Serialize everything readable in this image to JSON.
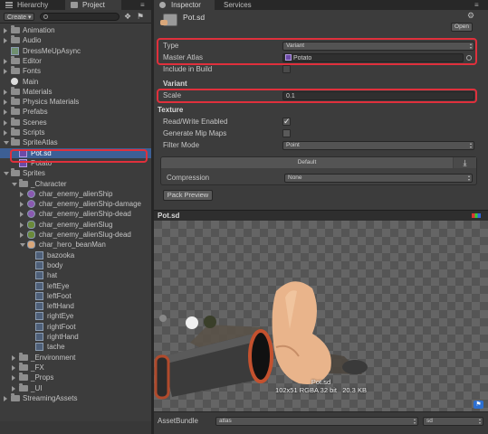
{
  "tabs": {
    "hierarchy": "Hierarchy",
    "project": "Project",
    "inspector": "Inspector",
    "services": "Services"
  },
  "project_toolbar": {
    "create_label": "Create ▾"
  },
  "project_tree": [
    {
      "label": "Animation",
      "type": "folder",
      "depth": 0,
      "expanded": false
    },
    {
      "label": "Audio",
      "type": "folder",
      "depth": 0,
      "expanded": false
    },
    {
      "label": "DressMeUpAsync",
      "type": "script",
      "depth": 0
    },
    {
      "label": "Editor",
      "type": "folder",
      "depth": 0,
      "expanded": false
    },
    {
      "label": "Fonts",
      "type": "folder",
      "depth": 0,
      "expanded": false
    },
    {
      "label": "Main",
      "type": "scene",
      "depth": 0
    },
    {
      "label": "Materials",
      "type": "folder",
      "depth": 0,
      "expanded": false
    },
    {
      "label": "Physics Materials",
      "type": "folder",
      "depth": 0,
      "expanded": false
    },
    {
      "label": "Prefabs",
      "type": "folder",
      "depth": 0,
      "expanded": false
    },
    {
      "label": "Scenes",
      "type": "folder",
      "depth": 0,
      "expanded": false
    },
    {
      "label": "Scripts",
      "type": "folder",
      "depth": 0,
      "expanded": false
    },
    {
      "label": "SpriteAtlas",
      "type": "folder",
      "depth": 0,
      "expanded": true
    },
    {
      "label": "Pot.sd",
      "type": "atlas",
      "depth": 1,
      "selected": true
    },
    {
      "label": "Potato",
      "type": "atlas",
      "depth": 1
    },
    {
      "label": "Sprites",
      "type": "folder",
      "depth": 0,
      "expanded": true
    },
    {
      "label": "_Character",
      "type": "folder",
      "depth": 1,
      "expanded": true
    },
    {
      "label": "char_enemy_alienShip",
      "type": "sprite-ship",
      "depth": 2,
      "expanded": false
    },
    {
      "label": "char_enemy_alienShip-damage",
      "type": "sprite-ship",
      "depth": 2,
      "expanded": false
    },
    {
      "label": "char_enemy_alienShip-dead",
      "type": "sprite-ship",
      "depth": 2,
      "expanded": false
    },
    {
      "label": "char_enemy_alienSlug",
      "type": "sprite-slug",
      "depth": 2,
      "expanded": false
    },
    {
      "label": "char_enemy_alienSlug-dead",
      "type": "sprite-slug",
      "depth": 2,
      "expanded": false
    },
    {
      "label": "char_hero_beanMan",
      "type": "sprite-bean",
      "depth": 2,
      "expanded": true
    },
    {
      "label": "bazooka",
      "type": "sprite",
      "depth": 3
    },
    {
      "label": "body",
      "type": "sprite",
      "depth": 3
    },
    {
      "label": "hat",
      "type": "sprite",
      "depth": 3
    },
    {
      "label": "leftEye",
      "type": "sprite",
      "depth": 3
    },
    {
      "label": "leftFoot",
      "type": "sprite",
      "depth": 3
    },
    {
      "label": "leftHand",
      "type": "sprite",
      "depth": 3
    },
    {
      "label": "rightEye",
      "type": "sprite",
      "depth": 3
    },
    {
      "label": "rightFoot",
      "type": "sprite",
      "depth": 3
    },
    {
      "label": "rightHand",
      "type": "sprite",
      "depth": 3
    },
    {
      "label": "tache",
      "type": "sprite",
      "depth": 3
    },
    {
      "label": "_Environment",
      "type": "folder",
      "depth": 1,
      "expanded": false
    },
    {
      "label": "_FX",
      "type": "folder",
      "depth": 1,
      "expanded": false
    },
    {
      "label": "_Props",
      "type": "folder",
      "depth": 1,
      "expanded": false
    },
    {
      "label": "_UI",
      "type": "folder",
      "depth": 1,
      "expanded": false
    },
    {
      "label": "StreamingAssets",
      "type": "folder",
      "depth": 0,
      "expanded": false
    }
  ],
  "inspector": {
    "asset_name": "Pot.sd",
    "open_button": "Open",
    "type_label": "Type",
    "type_value": "Variant",
    "master_atlas_label": "Master Atlas",
    "master_atlas_value": "Potato",
    "include_in_build_label": "Include in Build",
    "variant_header": "Variant",
    "scale_label": "Scale",
    "scale_value": "0.1",
    "texture_header": "Texture",
    "read_write_label": "Read/Write Enabled",
    "read_write_checked": true,
    "mipmaps_label": "Generate Mip Maps",
    "filter_mode_label": "Filter Mode",
    "filter_mode_value": "Point",
    "platform_tab": "Default",
    "compression_label": "Compression",
    "compression_value": "None",
    "pack_preview_button": "Pack Preview"
  },
  "preview": {
    "title": "Pot.sd",
    "caption_name": "Pot.sd",
    "caption_info": "102x51 RGBA 32 bit   20.3 KB"
  },
  "asset_bundle": {
    "label": "AssetBundle",
    "bundle_value": "atlas",
    "variant_value": "sd"
  },
  "colors": {
    "highlight_red": "#e0303c",
    "selection_blue": "#3d5f95",
    "atlas_purple": "#6c4aa8"
  }
}
